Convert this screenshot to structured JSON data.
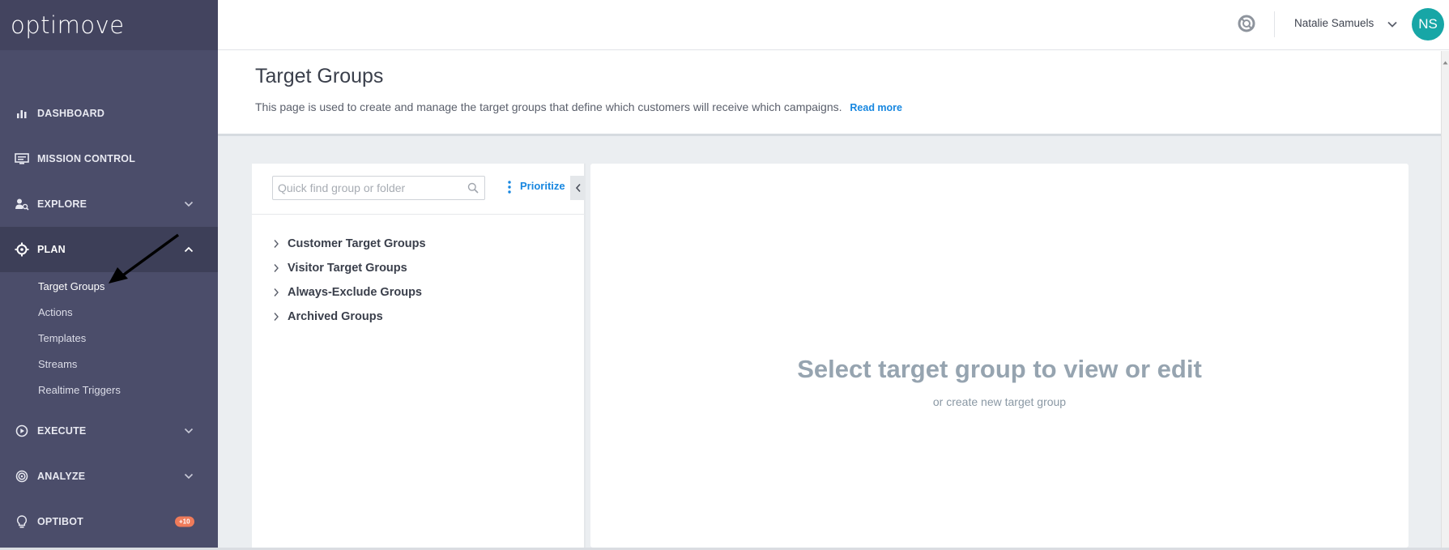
{
  "app": {
    "brand": "optimove"
  },
  "sidebar": {
    "items": [
      {
        "label": "DASHBOARD",
        "icon": "bar-chart-icon"
      },
      {
        "label": "MISSION CONTROL",
        "icon": "monitor-icon"
      },
      {
        "label": "EXPLORE",
        "icon": "user-search-icon"
      },
      {
        "label": "PLAN",
        "icon": "target-icon"
      },
      {
        "label": "EXECUTE",
        "icon": "play-circle-icon"
      },
      {
        "label": "ANALYZE",
        "icon": "radar-icon"
      },
      {
        "label": "OPTIBOT",
        "icon": "lightbulb-icon",
        "badge": "+10"
      }
    ],
    "plan_subitems": [
      "Target Groups",
      "Actions",
      "Templates",
      "Streams",
      "Realtime Triggers"
    ]
  },
  "topbar": {
    "user_name": "Natalie Samuels",
    "avatar_initials": "NS"
  },
  "header": {
    "title": "Target Groups",
    "description": "This page is used to create and manage the target groups that define which customers will receive which campaigns.",
    "read_more": "Read more"
  },
  "left_panel": {
    "search_placeholder": "Quick find group or folder",
    "prioritize_label": "Prioritize",
    "tree": [
      "Customer Target Groups",
      "Visitor Target Groups",
      "Always-Exclude Groups",
      "Archived Groups"
    ]
  },
  "right_panel": {
    "empty_title": "Select target group to view or edit",
    "empty_subtitle": "or create new target group"
  },
  "colors": {
    "sidebar_bg": "#4b4d6a",
    "accent_blue": "#1787e0",
    "avatar_bg": "#17a6a6",
    "badge_bg": "#ef7b5a"
  }
}
